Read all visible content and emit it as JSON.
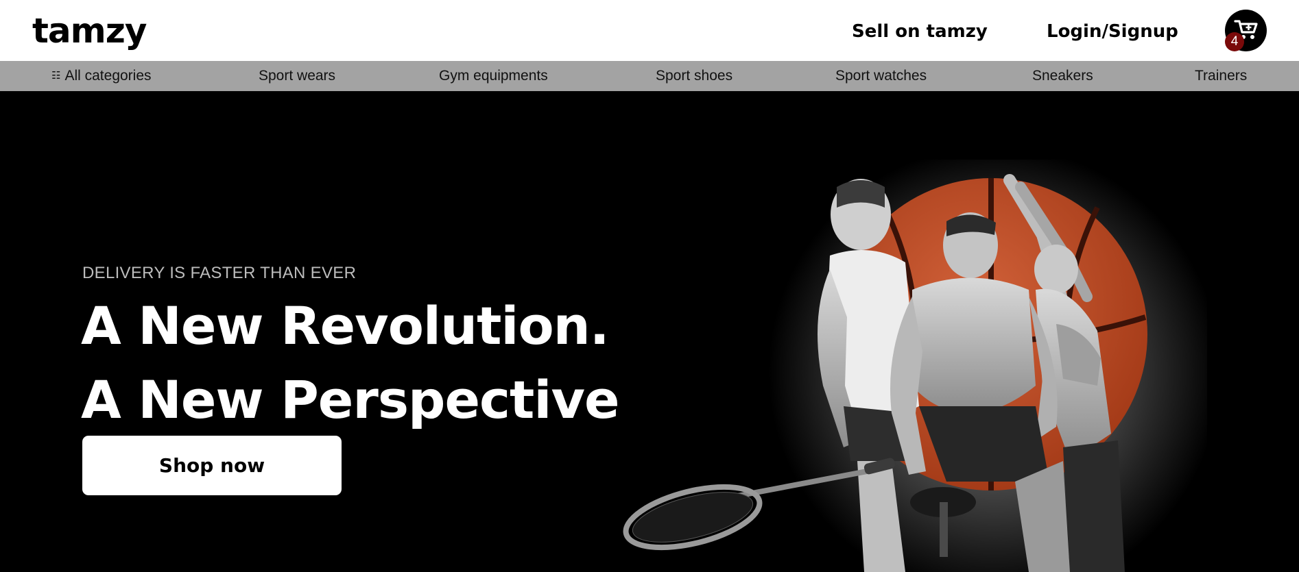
{
  "header": {
    "logo": "tamzy",
    "sell_label": "Sell on tamzy",
    "login_label": "Login/Signup",
    "cart": {
      "icon": "cart-plus-icon",
      "count": "4"
    }
  },
  "categories": {
    "all_label": "All categories",
    "all_icon": "☷",
    "items": [
      "Sport wears",
      "Gym equipments",
      "Sport shoes",
      "Sport watches",
      "Sneakers",
      "Trainers"
    ]
  },
  "hero": {
    "kicker": "DELIVERY IS FASTER THAN EVER",
    "headline_1": "A New Revolution.",
    "headline_2": "A New Perspective",
    "cta_label": "Shop now"
  },
  "colors": {
    "header_bg": "#ffffff",
    "nav_bg": "#a3a3a3",
    "hero_bg": "#000000",
    "accent_ball": "#c4532a",
    "badge": "#7a0a0a"
  }
}
